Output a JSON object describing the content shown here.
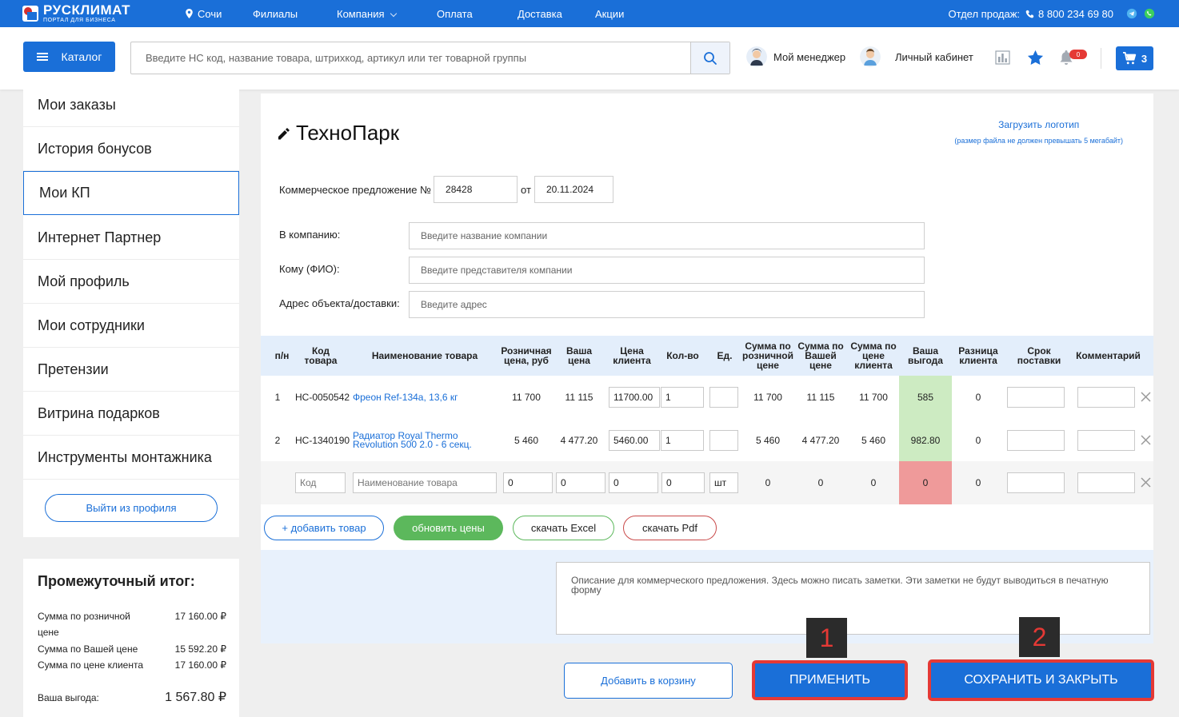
{
  "colors": {
    "brand": "#1a6fd8",
    "green": "#5cb85c",
    "danger": "#e53935",
    "benefit_positive": "#cdebc2",
    "benefit_zero": "#ef9a9a"
  },
  "topbar": {
    "brand_name": "РУСКЛИМАТ",
    "brand_sub": "ПОРТАЛ ДЛЯ БИЗНЕСА",
    "city": "Сочи",
    "nav": [
      "Филиалы",
      "Компания",
      "Оплата",
      "Доставка",
      "Акции"
    ],
    "sales_label": "Отдел продаж:",
    "phone": "8 800 234 69 80"
  },
  "header": {
    "catalog_label": "Каталог",
    "search_placeholder": "Введите НС код, название товара, штрихкод, артикул или тег товарной группы",
    "manager_label": "Мой менеджер",
    "cabinet_label": "Личный кабинет",
    "notifications_count": "0",
    "cart_count": "3"
  },
  "sidebar": {
    "items": [
      "Мои заказы",
      "История бонусов",
      "Мои КП",
      "Интернет Партнер",
      "Мой профиль",
      "Мои сотрудники",
      "Претензии",
      "Витрина подарков",
      "Инструменты монтажника"
    ],
    "active_index": 2,
    "logout_label": "Выйти из профиля"
  },
  "subtotal": {
    "title": "Промежуточный итог:",
    "retail_label": "Сумма по розничной цене",
    "retail_value": "17 160.00 ₽",
    "your_label": "Сумма по Вашей цене",
    "your_value": "15 592.20 ₽",
    "client_label": "Сумма по цене клиента",
    "client_value": "17 160.00 ₽",
    "benefit_label": "Ваша выгода:",
    "benefit_value": "1 567.80 ₽"
  },
  "kp": {
    "title": "ТехноПарк",
    "upload_logo": "Загрузить логотип",
    "upload_note": "(размер файла не должен превышать 5 мегабайт)",
    "number_label": "Коммерческое предложение №",
    "number": "28428",
    "date_label": "от",
    "date": "20.11.2024",
    "company_label": "В компанию:",
    "company_placeholder": "Введите название компании",
    "to_label": "Кому (ФИО):",
    "to_placeholder": "Введите представителя компании",
    "address_label": "Адрес объекта/доставки:",
    "address_placeholder": "Введите адрес"
  },
  "table": {
    "headers": [
      "п/н",
      "Код товара",
      "Наименование товара",
      "Розничная цена, руб",
      "Ваша цена",
      "Цена клиента",
      "Кол-во",
      "Ед.",
      "Сумма по розничной цене",
      "Сумма по Вашей цене",
      "Сумма по цене клиента",
      "Ваша выгода",
      "Разница клиента",
      "Срок поставки",
      "Комментарий"
    ],
    "rows": [
      {
        "n": "1",
        "code": "НС-0050542",
        "name": "Фреон Ref-134a, 13,6 кг",
        "retail": "11 700",
        "your": "11 115",
        "client": "11700.00",
        "qty": "1",
        "unit": "",
        "sum_retail": "11 700",
        "sum_your": "11 115",
        "sum_client": "11 700",
        "benefit": "585",
        "diff": "0"
      },
      {
        "n": "2",
        "code": "НС-1340190",
        "name": "Радиатор Royal Thermo Revolution 500 2.0 - 6 секц.",
        "retail": "5 460",
        "your": "4 477.20",
        "client": "5460.00",
        "qty": "1",
        "unit": "",
        "sum_retail": "5 460",
        "sum_your": "4 477.20",
        "sum_client": "5 460",
        "benefit": "982.80",
        "diff": "0"
      }
    ],
    "new_row": {
      "code_placeholder": "Код",
      "name_placeholder": "Наименование товара",
      "retail": "0",
      "your": "0",
      "client": "0",
      "qty": "0",
      "unit": "шт",
      "sum_retail": "0",
      "sum_your": "0",
      "sum_client": "0",
      "benefit": "0",
      "diff": "0"
    }
  },
  "actions": {
    "add_item": "+ добавить товар",
    "update_prices": "обновить цены",
    "download_excel": "скачать Excel",
    "download_pdf": "скачать Pdf"
  },
  "description_placeholder": "Описание для коммерческого предложения. Здесь можно писать заметки. Эти заметки не будут выводиться в печатную форму",
  "buttons": {
    "add_to_cart": "Добавить в корзину",
    "apply": "ПРИМЕНИТЬ",
    "save_close": "СОХРАНИТЬ И ЗАКРЫТЬ"
  },
  "markers": [
    "1",
    "2"
  ]
}
